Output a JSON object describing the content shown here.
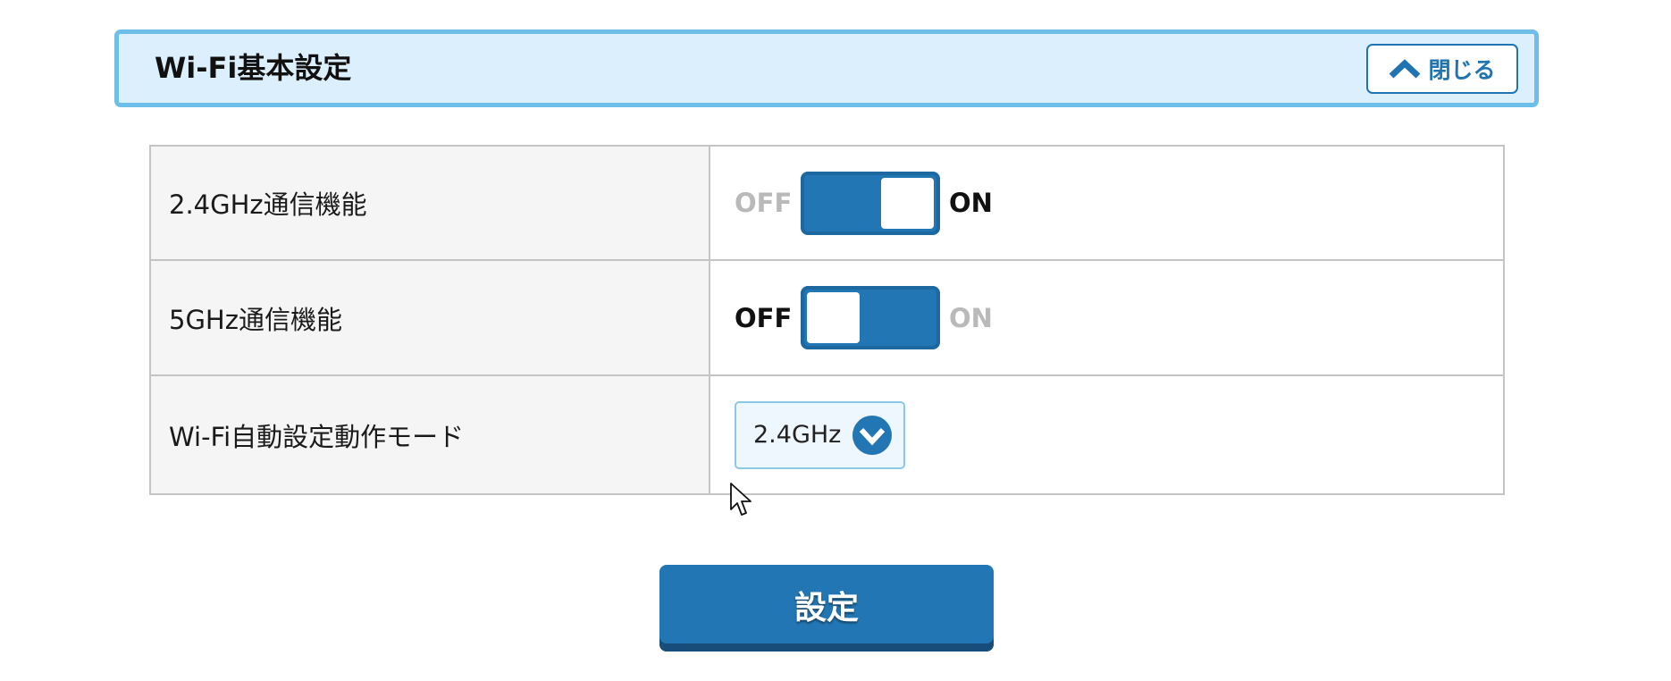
{
  "section": {
    "title": "Wi-Fi基本設定",
    "close_label": "閉じる"
  },
  "settings": {
    "rows": [
      {
        "label": "2.4GHz通信機能",
        "off_label": "OFF",
        "on_label": "ON",
        "state": "ON"
      },
      {
        "label": "5GHz通信機能",
        "off_label": "OFF",
        "on_label": "ON",
        "state": "OFF"
      },
      {
        "label": "Wi-Fi自動設定動作モード",
        "selected": "2.4GHz"
      }
    ]
  },
  "submit_label": "設定",
  "icons": {
    "close": "chevron-up-icon",
    "select": "chevron-down-circle-icon",
    "pointer": "mouse-cursor-icon"
  },
  "colors": {
    "accent": "#2276b3",
    "header_bg": "#dceffc",
    "header_border": "#6dbfea",
    "inactive_text": "#b9b9b9"
  }
}
